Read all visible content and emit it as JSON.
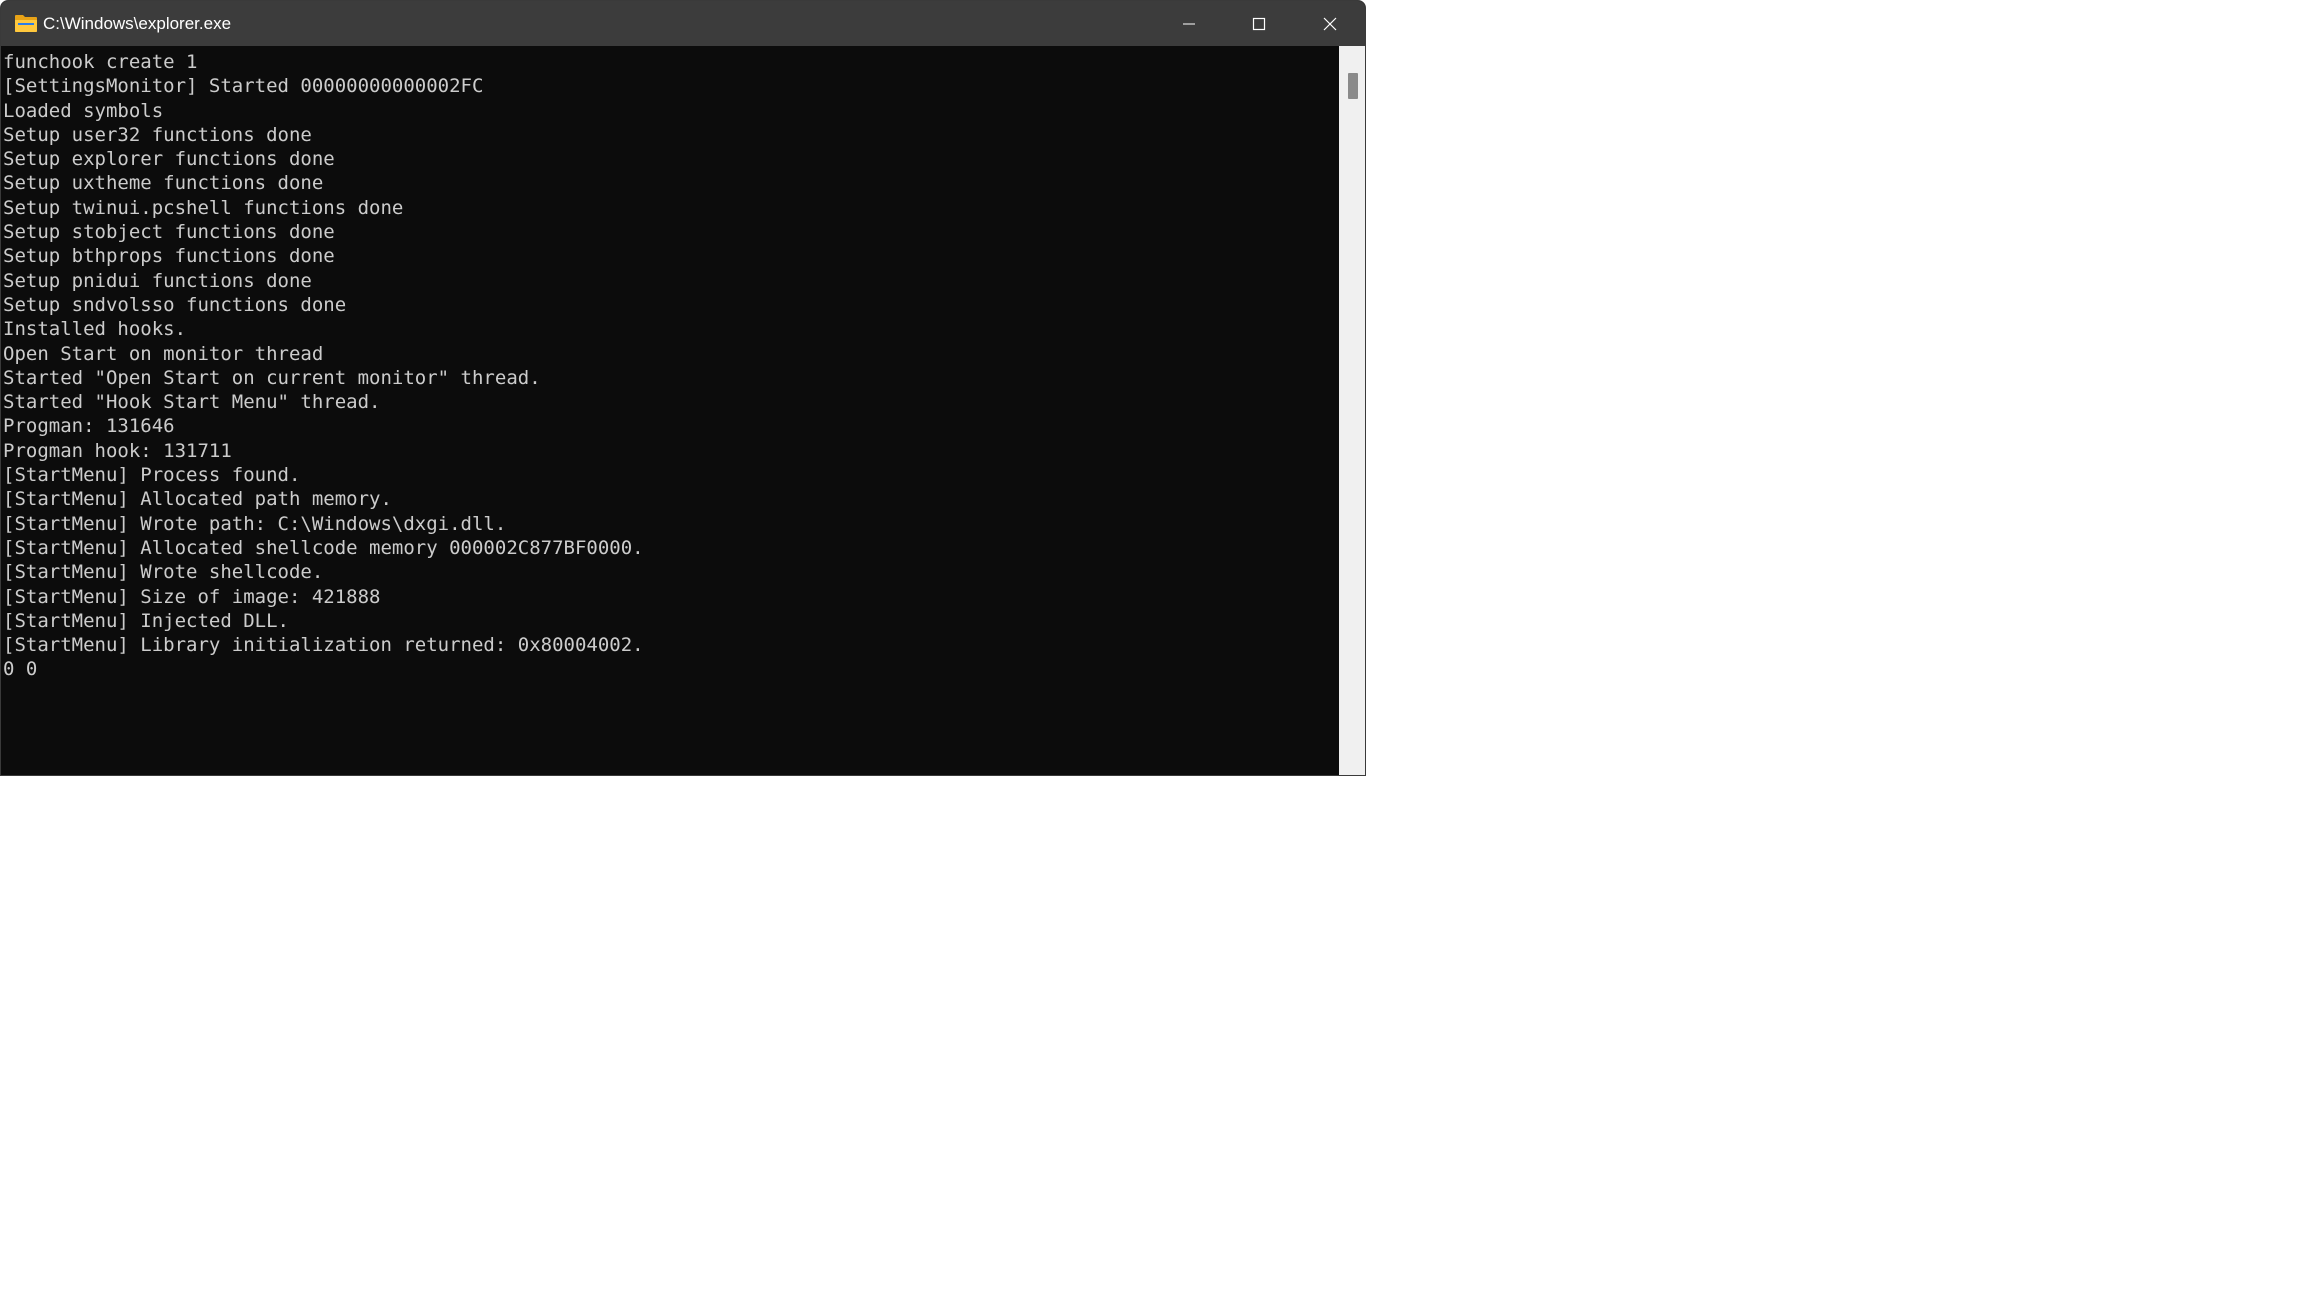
{
  "window": {
    "title": "C:\\Windows\\explorer.exe",
    "icon": "folder-icon"
  },
  "caption_buttons": {
    "minimize": "minimize-icon",
    "maximize": "maximize-icon",
    "close": "close-icon"
  },
  "console": {
    "lines": [
      "funchook create 1",
      "[SettingsMonitor] Started 00000000000002FC",
      "Loaded symbols",
      "Setup user32 functions done",
      "Setup explorer functions done",
      "Setup uxtheme functions done",
      "Setup twinui.pcshell functions done",
      "Setup stobject functions done",
      "Setup bthprops functions done",
      "Setup pnidui functions done",
      "Setup sndvolsso functions done",
      "Installed hooks.",
      "Open Start on monitor thread",
      "Started \"Open Start on current monitor\" thread.",
      "Started \"Hook Start Menu\" thread.",
      "Progman: 131646",
      "Progman hook: 131711",
      "[StartMenu] Process found.",
      "[StartMenu] Allocated path memory.",
      "[StartMenu] Wrote path: C:\\Windows\\dxgi.dll.",
      "[StartMenu] Allocated shellcode memory 000002C877BF0000.",
      "[StartMenu] Wrote shellcode.",
      "[StartMenu] Size of image: 421888",
      "[StartMenu] Injected DLL.",
      "[StartMenu] Library initialization returned: 0x80004002.",
      "0 0"
    ]
  },
  "colors": {
    "titlebar": "#3c3c3c",
    "console_bg": "#0c0c0c",
    "console_text": "#cccccc",
    "scrollbar_track": "#f0f0f0",
    "scrollbar_thumb": "#8a8a8a"
  }
}
